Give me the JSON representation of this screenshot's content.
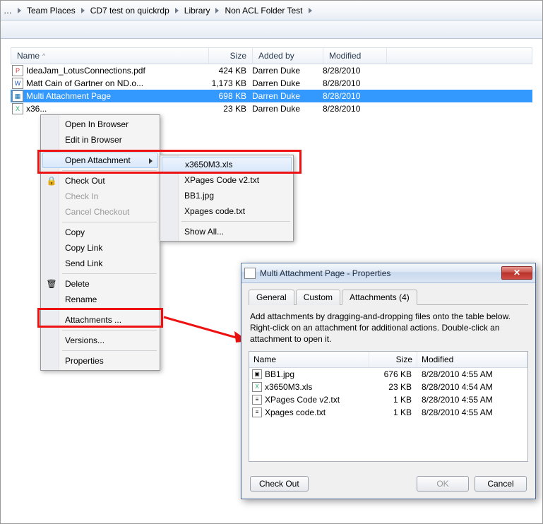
{
  "breadcrumb": [
    "Team Places",
    "CD7 test on quickrdp",
    "Library",
    "Non ACL Folder Test"
  ],
  "columns": {
    "name": "Name",
    "size": "Size",
    "added": "Added by",
    "modified": "Modified"
  },
  "sort_asc_glyph": "^",
  "files": [
    {
      "icon": "pdf",
      "name": "IdeaJam_LotusConnections.pdf",
      "size": "424 KB",
      "added": "Darren Duke",
      "modified": "8/28/2010"
    },
    {
      "icon": "doc",
      "name": "Matt Cain of Gartner on ND.o...",
      "size": "1,173 KB",
      "added": "Darren Duke",
      "modified": "8/28/2010"
    },
    {
      "icon": "pg",
      "name": "Multi Attachment Page",
      "size": "698 KB",
      "added": "Darren Duke",
      "modified": "8/28/2010",
      "selected": true
    },
    {
      "icon": "xls",
      "name": "x36...",
      "size": "23 KB",
      "added": "Darren Duke",
      "modified": "8/28/2010"
    }
  ],
  "ctx": {
    "open_browser": "Open In Browser",
    "edit_browser": "Edit in Browser",
    "open_attachment": "Open Attachment",
    "check_out": "Check Out",
    "check_in": "Check In",
    "cancel_checkout": "Cancel Checkout",
    "copy": "Copy",
    "copy_link": "Copy Link",
    "send_link": "Send Link",
    "delete": "Delete",
    "rename": "Rename",
    "attachments": "Attachments ...",
    "versions": "Versions...",
    "properties": "Properties"
  },
  "sub": {
    "items": [
      "x3650M3.xls",
      "XPages Code v2.txt",
      "BB1.jpg",
      "Xpages code.txt"
    ],
    "show_all": "Show All..."
  },
  "dlg": {
    "title": "Multi Attachment Page - Properties",
    "tabs": {
      "general": "General",
      "custom": "Custom",
      "attachments": "Attachments (4)"
    },
    "hint": "Add attachments by dragging-and-dropping files onto the table below. Right-click on an attachment for additional actions. Double-click an attachment to open it.",
    "cols": {
      "name": "Name",
      "size": "Size",
      "modified": "Modified"
    },
    "rows": [
      {
        "icon": "img",
        "name": "BB1.jpg",
        "size": "676 KB",
        "modified": "8/28/2010 4:55 AM"
      },
      {
        "icon": "xls",
        "name": "x3650M3.xls",
        "size": "23 KB",
        "modified": "8/28/2010 4:54 AM"
      },
      {
        "icon": "txt",
        "name": "XPages Code v2.txt",
        "size": "1 KB",
        "modified": "8/28/2010 4:55 AM"
      },
      {
        "icon": "txt",
        "name": "Xpages code.txt",
        "size": "1 KB",
        "modified": "8/28/2010 4:55 AM"
      }
    ],
    "btn_checkout": "Check Out",
    "btn_ok": "OK",
    "btn_cancel": "Cancel",
    "close_glyph": "✕"
  },
  "icon_glyphs": {
    "pdf": "P",
    "doc": "W",
    "pg": "▦",
    "xls": "X",
    "img": "▣",
    "txt": "≡",
    "lock": "🔒",
    "trash": "🗑"
  }
}
